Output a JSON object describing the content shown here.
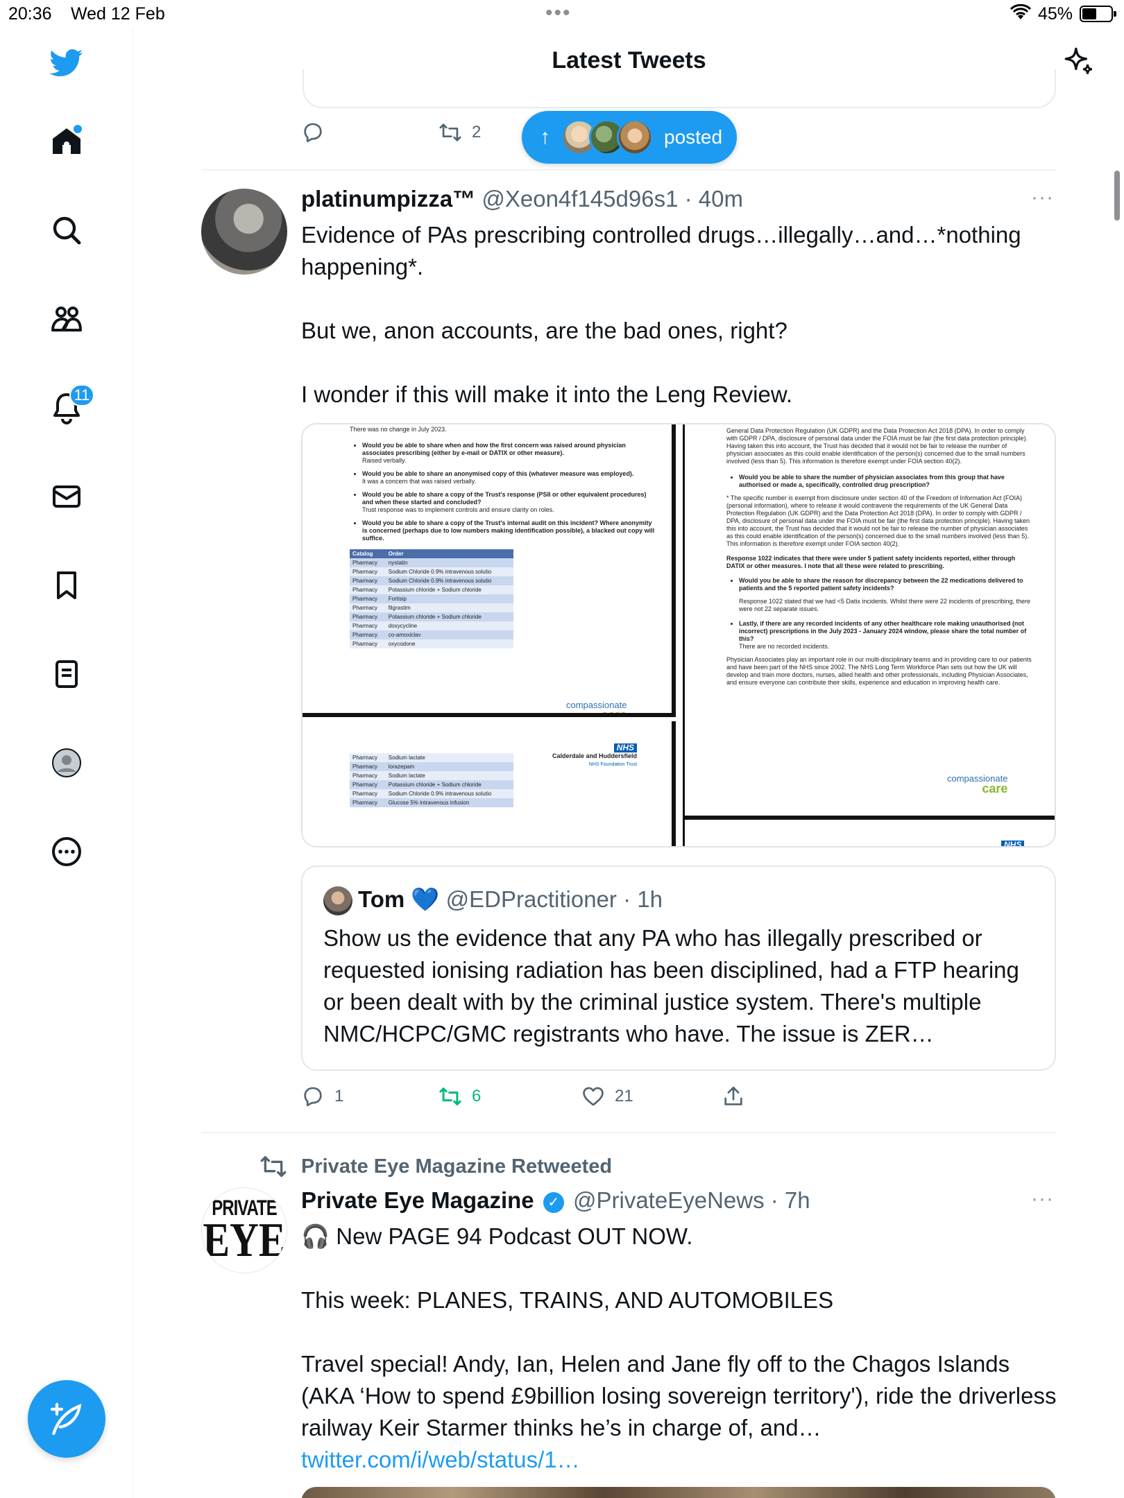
{
  "status_bar": {
    "time": "20:36",
    "date": "Wed 12 Feb",
    "battery": "45%"
  },
  "header": {
    "title": "Latest Tweets"
  },
  "sidebar": {
    "notifications_badge": "11",
    "items": [
      "home-icon",
      "search-icon",
      "communities-icon",
      "notifications-icon",
      "messages-icon",
      "bookmarks-icon",
      "lists-icon",
      "profile-icon",
      "more-icon"
    ]
  },
  "previous_tweet": {
    "retweets": "2"
  },
  "posted_pill": {
    "arrow": "↑",
    "label": "posted"
  },
  "tweet1": {
    "name": "platinumpizza™",
    "meta": "@Xeon4f145d96s1 · 40m",
    "more": "···",
    "text": "Evidence of PAs prescribing controlled drugs…illegally…and…*nothing happening*.\n\nBut we, anon accounts, are the bad ones, right?\n\nI wonder if this will make it into the Leng Review.",
    "quote": {
      "name": "Tom",
      "heart": "💙",
      "meta": "@EDPractitioner · 1h",
      "text": "Show us the evidence that any PA who has illegally prescribed or requested ionising radiation has been disciplined, had a FTP hearing or been dealt with by the criminal justice system. There's multiple NMC/HCPC/GMC registrants who have. The issue is ZER…"
    },
    "replies": "1",
    "retweets": "6",
    "likes": "21"
  },
  "doc_images": {
    "doc_a": {
      "top": "There was no change in July 2023.",
      "bullets": [
        {
          "q": "Would you be able to share when and how the first concern was raised around physician associates prescribing (either by e-mail or DATIX or other measure).",
          "a": "Raised verbally."
        },
        {
          "q": "Would you be able to share an anonymised copy of this (whatever measure was employed).",
          "a": "It was a concern that was raised verbally."
        },
        {
          "q": "Would you be able to share a copy of the Trust's response (PSII or other equivalent procedures) and when these started and concluded?",
          "a": "Trust response was to implement controls and ensure clarity on roles."
        },
        {
          "q": "Would you be able to share a copy of the Trust's internal audit on this incident? Where anonymity is concerned (perhaps due to low numbers making identification possible), a blacked out copy will suffice.",
          "a": ""
        }
      ],
      "table_head": [
        "Catalog",
        "Order"
      ],
      "table_rows": [
        [
          "Pharmacy",
          "nystatin"
        ],
        [
          "Pharmacy",
          "Sodium Chloride 0.9% intravenous solutio"
        ],
        [
          "Pharmacy",
          "Sodium Chloride 0.9% intravenous solutio"
        ],
        [
          "Pharmacy",
          "Potassium chloride + Sodium chloride"
        ],
        [
          "Pharmacy",
          "Fortisip"
        ],
        [
          "Pharmacy",
          "filgrastim"
        ],
        [
          "Pharmacy",
          "Potassium chloride + Sodium chloride"
        ],
        [
          "Pharmacy",
          "doxycycline"
        ],
        [
          "Pharmacy",
          "co-amoxiclav"
        ],
        [
          "Pharmacy",
          "oxycodone"
        ]
      ],
      "logo_line1": "compassionate",
      "logo_line2": "care"
    },
    "doc_b": {
      "table_rows": [
        [
          "Pharmacy",
          "Sodium lactate"
        ],
        [
          "Pharmacy",
          "lorazepam"
        ],
        [
          "Pharmacy",
          "Sodium lactate"
        ],
        [
          "Pharmacy",
          "Potassium chloride + Sodium chloride"
        ],
        [
          "Pharmacy",
          "Sodium Chloride 0.9% intravenous solutio"
        ],
        [
          "Pharmacy",
          "Glucose 5% intravenous infusion"
        ]
      ],
      "nhs": "NHS",
      "trust": "Calderdale and Huddersfield",
      "trust_sub": "NHS Foundation Trust"
    },
    "doc_c": {
      "para1": "General Data Protection Regulation (UK GDPR) and the Data Protection Act 2018 (DPA). In order to comply with GDPR / DPA, disclosure of personal data under the FOIA must be fair (the first data protection principle). Having taken this into account, the Trust has decided that it would not be fair to release the number of physician associates as this could enable identification of the person(s) concerned due to the small numbers involved (less than 5). This information is therefore exempt under FOIA section 40(2).",
      "q1": "Would you be able to share the number of physician associates from this group that have authorised or made a, specifically, controlled drug prescription?",
      "a1": "* The specific number is exempt from disclosure under section 40 of the Freedom of Information Act (FOIA) (personal information), where to release it would contravene the requirements of the UK General Data Protection Regulation (UK GDPR) and the Data Protection Act 2018 (DPA). In order to comply with GDPR / DPA, disclosure of personal data under the FOIA must be fair (the first data protection principle). Having taken this into account, the Trust has decided that it would not be fair to release the number of physician associates as this could enable identification of the person(s) concerned due to the small numbers involved (less than 5). This information is therefore exempt under FOIA section 40(2).",
      "response": "Response 1022 indicates that there were under 5 patient safety incidents reported, either through DATIX or other measures. I note that all these were related to prescribing.",
      "q2": "Would you be able to share the reason for discrepancy between the 22 medications delivered to patients and the 5 reported patient safety incidents?",
      "a2": "Response 1022 stated that we had <5 Datix incidents. Whilst there were 22 incidents of prescribing, there were not 22 separate issues.",
      "q3": "Lastly, if there are any recorded incidents of any other healthcare role making unauthorised (not incorrect) prescriptions in the July 2023 - January 2024 window, please share the total number of this?",
      "a3": "There are no recorded incidents.",
      "closing": "Physician Associates play an important role in our multi-disciplinary teams and in providing care to our patients and have been part of the NHS since 2002. The NHS Long Term Workforce Plan sets out how the UK will develop and train more doctors, nurses, allied health and other professionals, including Physician Associates, and ensure everyone can contribute their skills, experience and education in improving health care.",
      "logo_line1": "compassionate",
      "logo_line2": "care",
      "nhs": "NHS"
    }
  },
  "retweet_banner": {
    "label": "Private Eye Magazine Retweeted"
  },
  "tweet2": {
    "avatar_top": "PRIVATE",
    "avatar_bottom": "EYE",
    "name": "Private Eye Magazine",
    "verified": "✓",
    "meta": "@PrivateEyeNews · 7h",
    "more": "···",
    "text": "🎧 New PAGE 94 Podcast OUT NOW.\n\nThis week: PLANES, TRAINS, AND AUTOMOBILES\n\nTravel special! Andy, Ian, Helen and Jane fly off to the Chagos Islands (AKA ‘How to spend £9billion losing sovereign territory'), ride the driverless railway Keir Starmer thinks he’s in charge of, and…",
    "link": "twitter.com/i/web/status/1…"
  },
  "colors": {
    "accent": "#1d9bf0",
    "retweet_active": "#00ba7c",
    "secondary_text": "#536471"
  }
}
